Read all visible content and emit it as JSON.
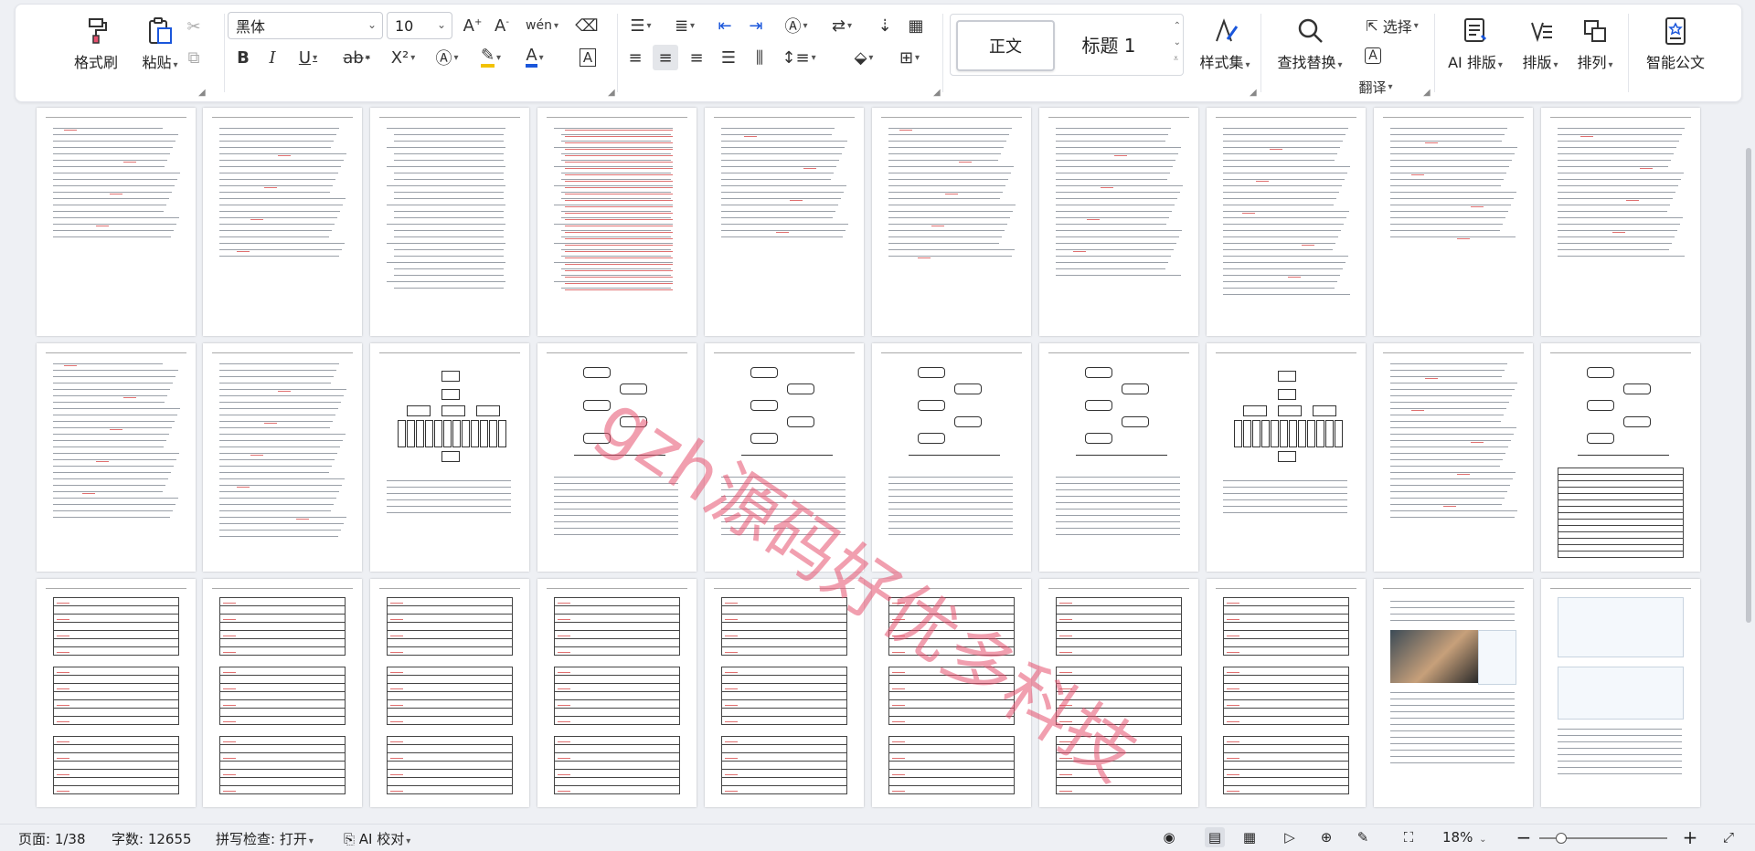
{
  "ribbon": {
    "format_painter_label": "格式刷",
    "paste_label": "粘贴",
    "font_name": "黑体",
    "font_size": "10",
    "style_normal": "正文",
    "style_heading1": "标题 1",
    "styles_label": "样式集",
    "find_replace_label": "查找替换",
    "select_label": "选择",
    "translate_label": "翻译",
    "ai_layout_label": "AI 排版",
    "layout_label": "排版",
    "arrange_label": "排列",
    "smart_doc_label": "智能公文"
  },
  "watermark": {
    "text": "gzh源码好优多科技"
  },
  "status": {
    "page": "页面: 1/38",
    "word_count": "字数: 12655",
    "spell_check": "拼写检查: 打开",
    "ai_proof": "AI 校对",
    "zoom": "18%"
  },
  "colors": {
    "accent": "#1a56db",
    "watermark": "#e6506e",
    "highlight": "#f2c200",
    "font_color": "#1a56db"
  }
}
